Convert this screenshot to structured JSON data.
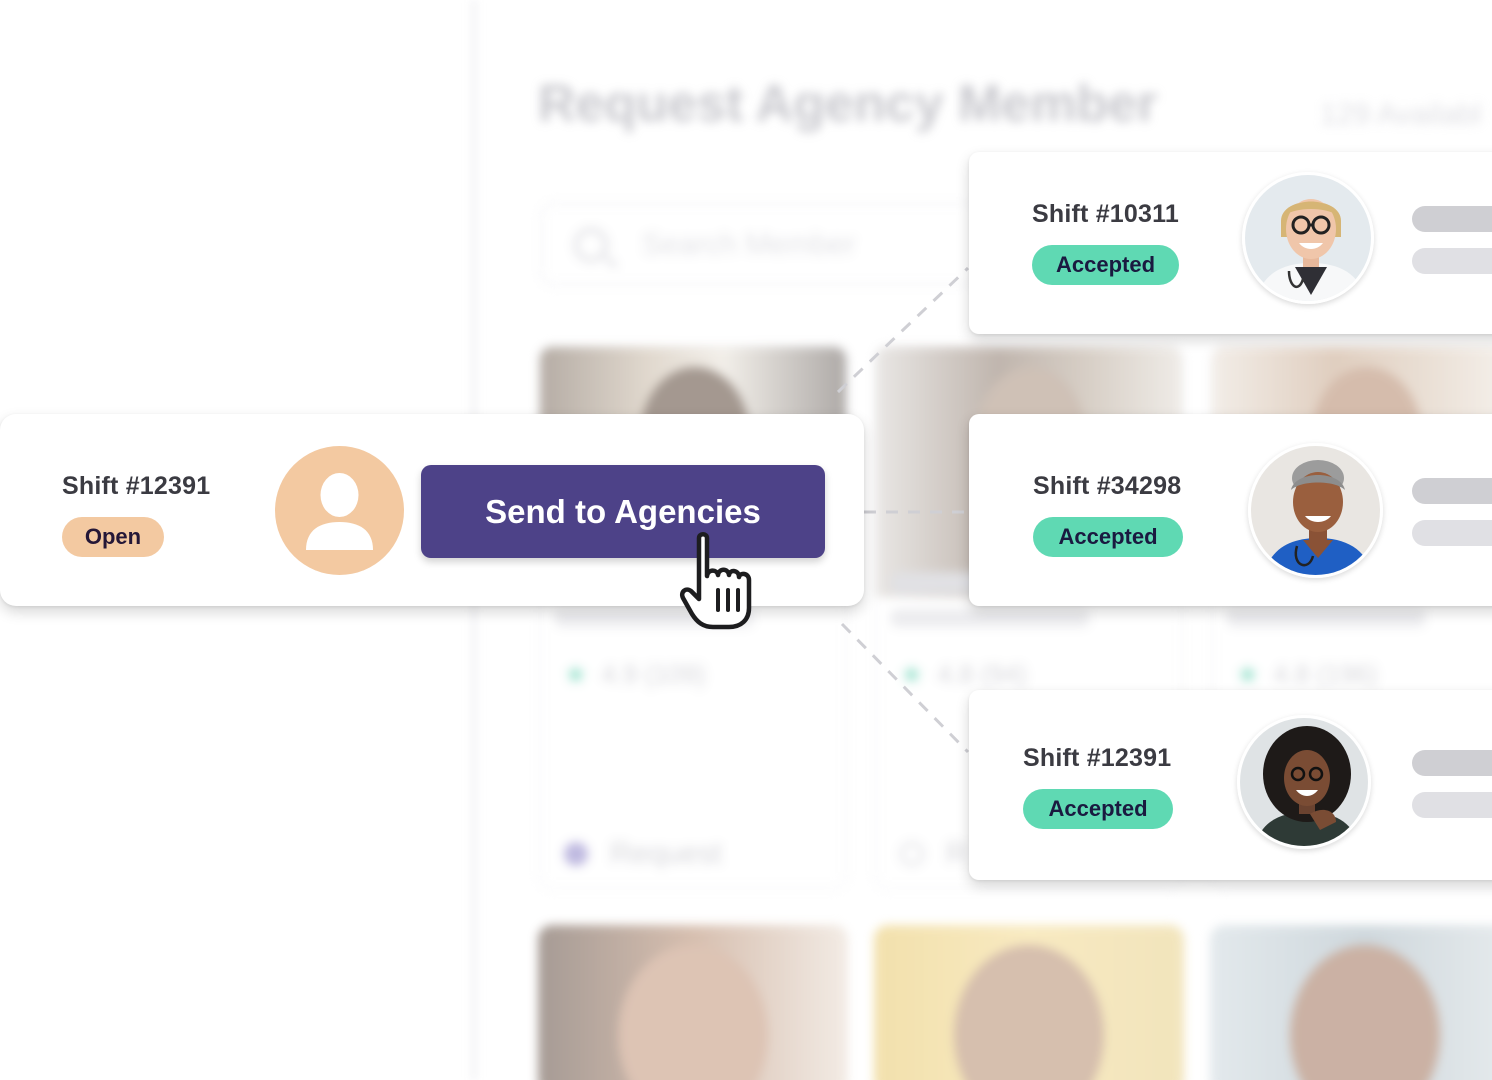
{
  "background_app": {
    "title": "Request Agency Member",
    "available": "129 Availabl",
    "search_placeholder": "Search Member",
    "member_cards": [
      {
        "rating": "4.9",
        "reviews": "(109)",
        "action": "Request"
      },
      {
        "rating": "4.8",
        "reviews": "(94)",
        "action": "R"
      },
      {
        "rating": "4.8",
        "reviews": "(196)",
        "action": ""
      }
    ]
  },
  "open_shift": {
    "shift_label": "Shift #12391",
    "status": "Open",
    "avatar_icon": "user-placeholder-icon",
    "send_button": "Send to Agencies",
    "cursor_icon": "hand-pointer-icon"
  },
  "accepted_shifts": [
    {
      "shift_label": "Shift #10311",
      "status": "Accepted",
      "avatar_icon": "doctor-avatar"
    },
    {
      "shift_label": "Shift #34298",
      "status": "Accepted",
      "avatar_icon": "nurse-avatar"
    },
    {
      "shift_label": "Shift #12391",
      "status": "Accepted",
      "avatar_icon": "clinician-avatar"
    }
  ],
  "colors": {
    "primary_button": "#4d4288",
    "open_badge": "#f3c9a1",
    "accepted_badge": "#5fd9b3",
    "star": "#45c9a3"
  }
}
